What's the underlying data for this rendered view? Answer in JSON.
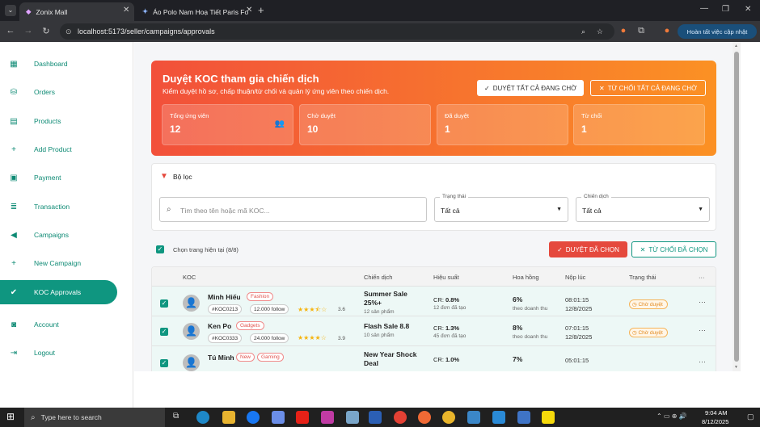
{
  "browser": {
    "tabs": [
      {
        "title": "Zonix Mall",
        "active": true
      },
      {
        "title": "Áo Polo Nam Hoạ Tiết Paris Fo",
        "active": false
      }
    ],
    "url": "localhost:5173/seller/campaigns/approvals",
    "update_button": "Hoàn tất việc cập nhật"
  },
  "sidebar": {
    "items": [
      {
        "label": "Dashboard",
        "icon": "dashboard-icon"
      },
      {
        "label": "Orders",
        "icon": "bag-icon"
      },
      {
        "label": "Products",
        "icon": "box-icon"
      },
      {
        "label": "Add Product",
        "icon": "plus-icon"
      },
      {
        "label": "Payment",
        "icon": "wallet-icon"
      },
      {
        "label": "Transaction",
        "icon": "list-icon"
      },
      {
        "label": "Campaigns",
        "icon": "megaphone-icon"
      },
      {
        "label": "New Campaign",
        "icon": "plus-icon"
      },
      {
        "label": "KOC Approvals",
        "icon": "person-check-icon",
        "active": true
      },
      {
        "label": "Account",
        "icon": "account-icon"
      },
      {
        "label": "Logout",
        "icon": "logout-icon"
      }
    ]
  },
  "header": {
    "title": "Duyệt KOC tham gia chiến dịch",
    "subtitle": "Kiểm duyệt hồ sơ, chấp thuận/từ chối và quản lý ứng viên theo chiến dịch.",
    "approve_all": "DUYỆT TẤT CẢ ĐANG CHỜ",
    "reject_all": "TỪ CHỐI TẤT CẢ ĐANG CHỜ"
  },
  "stats": [
    {
      "label": "Tổng ứng viên",
      "value": "12"
    },
    {
      "label": "Chờ duyệt",
      "value": "10"
    },
    {
      "label": "Đã duyệt",
      "value": "1"
    },
    {
      "label": "Từ chối",
      "value": "1"
    }
  ],
  "filter": {
    "title": "Bộ lọc",
    "search_placeholder": "Tìm theo tên hoặc mã KOC...",
    "status_label": "Trạng thái",
    "status_value": "Tất cả",
    "campaign_label": "Chiến dịch",
    "campaign_value": "Tất cả"
  },
  "toolbar": {
    "select_page": "Chọn trang hiện tại (8/8)",
    "approve_selected": "DUYỆT ĐÃ CHỌN",
    "reject_selected": "TỪ CHỐI ĐÃ CHỌN"
  },
  "table": {
    "headers": [
      "KOC",
      "Chiến dịch",
      "Hiệu suất",
      "Hoa hồng",
      "Nộp lúc",
      "Trạng thái",
      "···"
    ],
    "rows": [
      {
        "name": "Minh Hiếu",
        "tag": "Fashion",
        "code": "#KOC0213",
        "followers": "12.000 follow",
        "stars": 3.5,
        "rating": "3.6",
        "campaign": "Summer Sale 25%+",
        "products": "12 sản phẩm",
        "cr": "0.8%",
        "orders": "12 đơn đã tạo",
        "commission": "6%",
        "commission_sub": "theo doanh thu",
        "time": "08:01:15",
        "date": "12/8/2025",
        "status": "Chờ duyệt"
      },
      {
        "name": "Ken Po",
        "tag": "Gadgets",
        "code": "#KOC0333",
        "followers": "24.000 follow",
        "stars": 4,
        "rating": "3.9",
        "campaign": "Flash Sale 8.8",
        "products": "10 sản phẩm",
        "cr": "1.3%",
        "orders": "45 đơn đã tạo",
        "commission": "8%",
        "commission_sub": "theo doanh thu",
        "time": "07:01:15",
        "date": "12/8/2025",
        "status": "Chờ duyệt"
      },
      {
        "name": "Tú Minh",
        "tag": "New",
        "tag2": "Gaming",
        "code": "",
        "followers": "",
        "stars": 0,
        "rating": "",
        "campaign": "New Year Shock Deal",
        "products": "",
        "cr": "1.0%",
        "orders": "",
        "commission": "7%",
        "commission_sub": "",
        "time": "05:01:15",
        "date": "",
        "status": ""
      }
    ]
  },
  "taskbar": {
    "search_placeholder": "Type here to search",
    "time": "9:04 AM",
    "date": "8/12/2025"
  },
  "colors": {
    "primary": "#0f9680",
    "accent_start": "#f2503a",
    "accent_end": "#fb9124",
    "danger": "#e5493d"
  }
}
